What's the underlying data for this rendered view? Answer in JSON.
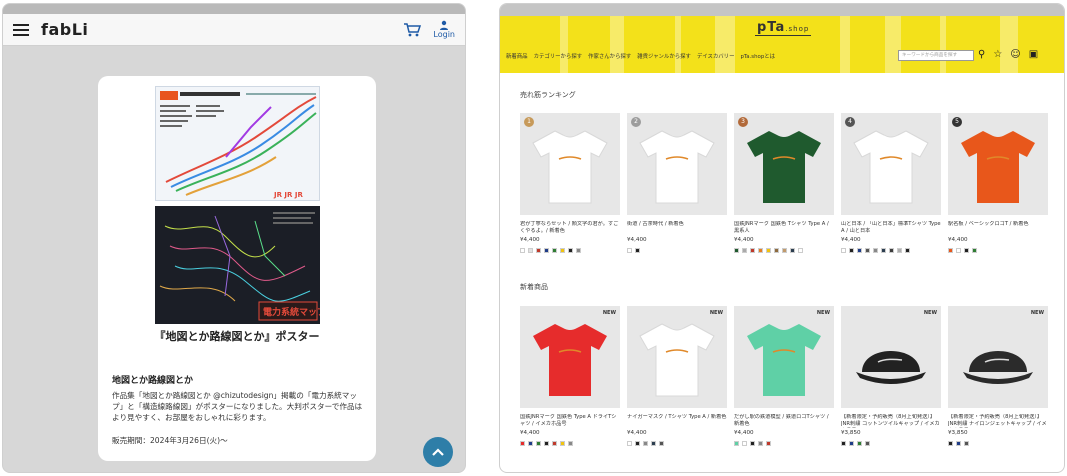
{
  "left": {
    "brand": "fabLi",
    "login_label": "Login",
    "poster_title": "『地図とか路線図とか』ポスター",
    "heading": "地図とか路線図とか",
    "description": "作品集「地図とか路線図とか @chizutodesign」掲載の「電力系統マップ」と「構造線路線図」がポスターになりました。大判ポスターで作品はより見やすく、お部屋をおしゃれに彩ります。",
    "sale_date": "販売期間：2024年3月26日(火)〜",
    "poster1_label": "JR 構造線路線図",
    "poster2_label": "電力系統マップ"
  },
  "right": {
    "logo": "pTa",
    "logo_suffix": ".shop",
    "nav": [
      "新着商品",
      "カテゴリーから探す",
      "作家さんから探す",
      "雑貨ジャンルから探す",
      "デイスカバリー",
      "pTa.shopとは"
    ],
    "search_placeholder": "キーワードから商品を探す",
    "ranking_title": "売れ筋ランキング",
    "new_title": "新着商品",
    "ranking": [
      {
        "rank": "1",
        "name": "君が丁寧ならセット / 顔文字の君が。すごくやるよ。/ 新着色",
        "price": "¥4,400",
        "color": "#ffffff",
        "rankcolor": "#c79a5a",
        "swatches": [
          "#ffffff",
          "#e2e2e2",
          "#c0392b",
          "#1f3c88",
          "#2e7d32",
          "#f1c40f",
          "#222222",
          "#888888"
        ]
      },
      {
        "rank": "2",
        "name": "街道 / 古茶時代 / 新着色",
        "price": "¥4,400",
        "color": "#ffffff",
        "rankcolor": "#9c9c9c",
        "swatches": [
          "#ffffff",
          "#222222"
        ]
      },
      {
        "rank": "3",
        "name": "国鉄JNRマーク 国鉄色 Tシャツ Type A / 黒系人",
        "price": "¥4,400",
        "color": "#1f5a2e",
        "rankcolor": "#b26a3a",
        "swatches": [
          "#1f5a2e",
          "#aaaaaa",
          "#c0392b",
          "#e67e22",
          "#f1c40f",
          "#8e6b3e",
          "#c19a6b",
          "#2c3e50",
          "#ffffff"
        ]
      },
      {
        "rank": "4",
        "name": "山と日本 / 「山と日本」標準Tシャツ Type A / 山と日本",
        "price": "¥4,400",
        "color": "#ffffff",
        "rankcolor": "#555555",
        "swatches": [
          "#ffffff",
          "#222222",
          "#1f3c88",
          "#555555",
          "#888888",
          "#2c3e50",
          "#3d3d3d",
          "#b0b0b0",
          "#222222"
        ]
      },
      {
        "rank": "5",
        "name": "駅名板 / ベーシックロゴT / 新着色",
        "price": "¥4,400",
        "color": "#e8571b",
        "rankcolor": "#333333",
        "swatches": [
          "#e8571b",
          "#ffffff",
          "#222222",
          "#2e7d32"
        ]
      }
    ],
    "new_items": [
      {
        "name": "国鉄JNRマーク 国鉄色 Type A ドライTシャツ / イメカホ品号",
        "price": "¥4,400",
        "color": "#e62c2c",
        "new_label": "NEW",
        "swatches": [
          "#e62c2c",
          "#1f3c88",
          "#2e7d32",
          "#222222",
          "#c0392b",
          "#f1c40f",
          "#888888"
        ]
      },
      {
        "name": "ナイガーマスク / Tシャツ Type A / 新着色",
        "price": "¥4,400",
        "color": "#ffffff",
        "new_label": "NEW",
        "swatches": [
          "#ffffff",
          "#222222",
          "#888888",
          "#2c3e50",
          "#555555"
        ]
      },
      {
        "name": "だがし駅の鉄道模型 / 鉄道ロゴTシャツ / 新着色",
        "price": "¥4,400",
        "color": "#5fd0a6",
        "new_label": "NEW",
        "swatches": [
          "#5fd0a6",
          "#ffffff",
          "#222222",
          "#888888",
          "#c0392b"
        ]
      },
      {
        "name": "【新着限定・予約販売（8月上旬発送）】JNR刺繍 コットンツイルキャップ / イメカホ品号",
        "price": "¥3,850",
        "color": "#222222",
        "new_label": "NEW",
        "swatches": [
          "#222222",
          "#1f3c88",
          "#2e7d32",
          "#555555"
        ]
      },
      {
        "name": "【新着限定・予約販売（8月上旬発送）】JNR刺繍 ナイロンジェットキャップ / イメカホ品号",
        "price": "¥3,850",
        "color": "#2b2b2b",
        "new_label": "NEW",
        "swatches": [
          "#222222",
          "#1f3c88",
          "#555555"
        ]
      }
    ]
  }
}
